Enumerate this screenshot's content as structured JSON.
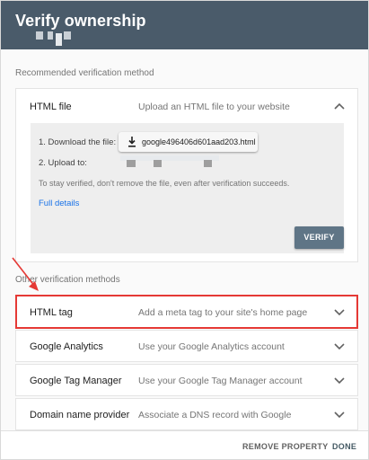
{
  "header": {
    "title": "Verify ownership"
  },
  "recommended": {
    "section_label": "Recommended verification method",
    "title": "HTML file",
    "description": "Upload an HTML file to your website",
    "step1_label": "1. Download the file:",
    "download_file": "google496406d601aad203.html",
    "step2_label": "2. Upload to:",
    "note": "To stay verified, don't remove the file, even after verification succeeds.",
    "details_link": "Full details",
    "verify_button": "VERIFY"
  },
  "other": {
    "section_label": "Other verification methods",
    "methods": [
      {
        "title": "HTML tag",
        "description": "Add a meta tag to your site's home page"
      },
      {
        "title": "Google Analytics",
        "description": "Use your Google Analytics account"
      },
      {
        "title": "Google Tag Manager",
        "description": "Use your Google Tag Manager account"
      },
      {
        "title": "Domain name provider",
        "description": "Associate a DNS record with Google"
      }
    ]
  },
  "footer": {
    "remove_button": "REMOVE PROPERTY",
    "done_button": "DONE"
  },
  "colors": {
    "header_bg": "#4a5b6a",
    "verify_bg": "#5f7586",
    "link": "#1a73e8",
    "highlight": "#e53935"
  },
  "icons": [
    "chevron-up-icon",
    "download-icon",
    "chevron-down-icon",
    "annotation-arrow-icon"
  ]
}
